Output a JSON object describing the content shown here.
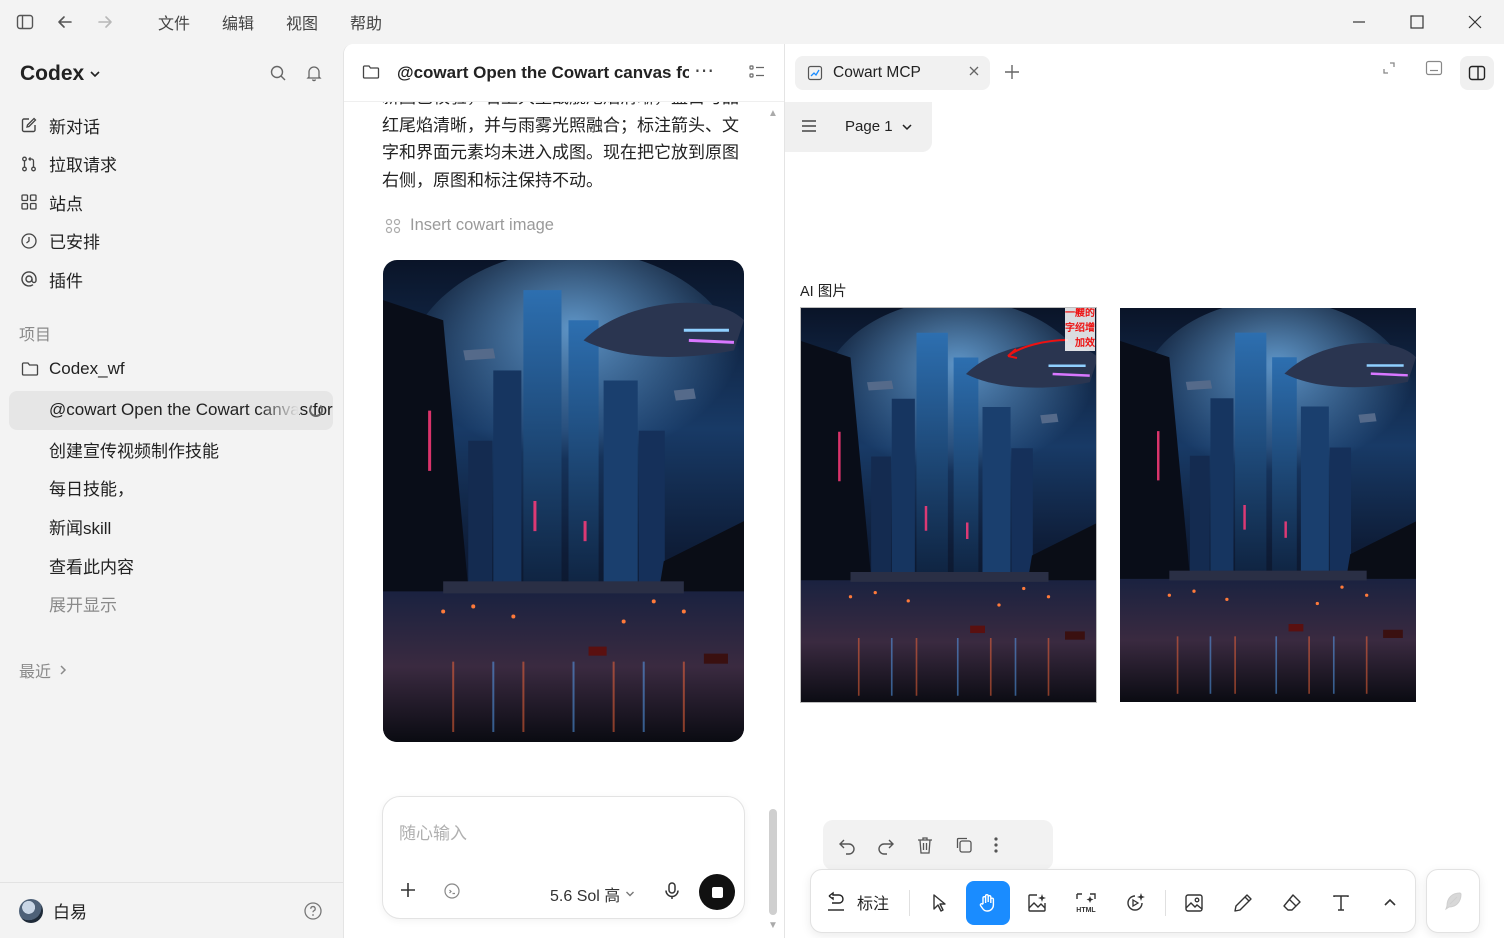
{
  "menu": [
    "文件",
    "编辑",
    "视图",
    "帮助"
  ],
  "sidebar": {
    "brand": "Codex",
    "nav": [
      {
        "label": "新对话",
        "icon": "edit-icon"
      },
      {
        "label": "拉取请求",
        "icon": "pull-request-icon"
      },
      {
        "label": "站点",
        "icon": "grid-icon"
      },
      {
        "label": "已安排",
        "icon": "clock-icon"
      },
      {
        "label": "插件",
        "icon": "at-icon"
      }
    ],
    "projects_label": "项目",
    "project": "Codex_wf",
    "threads": [
      "@cowart Open the Cowart canvas for",
      "创建宣传视频制作技能",
      "每日技能，",
      "新闻skill",
      "查看此内容"
    ],
    "show_more": "展开显示",
    "recent_label": "最近",
    "user": "白易"
  },
  "chat": {
    "title": "@cowart Open the Cowart canvas for",
    "message": "新图已校验，右上大型战舰尾焰清晰，蓝白与品红尾焰清晰，并与雨雾光照融合；标注箭头、文字和界面元素均未进入成图。现在把它放到原图右侧，原图和标注保持不动。",
    "tool_call": "Insert cowart image",
    "composer": {
      "placeholder": "随心输入",
      "model": "5.6 Sol 高"
    }
  },
  "canvas": {
    "tab_title": "Cowart MCP",
    "page": "Page 1",
    "frame_label": "AI 图片",
    "annotation_text": "一艘的字绍增加效",
    "toolbar": {
      "annotate_label": "标注"
    }
  },
  "colors": {
    "accent": "#1a8cff",
    "annotation": "#e11111"
  }
}
